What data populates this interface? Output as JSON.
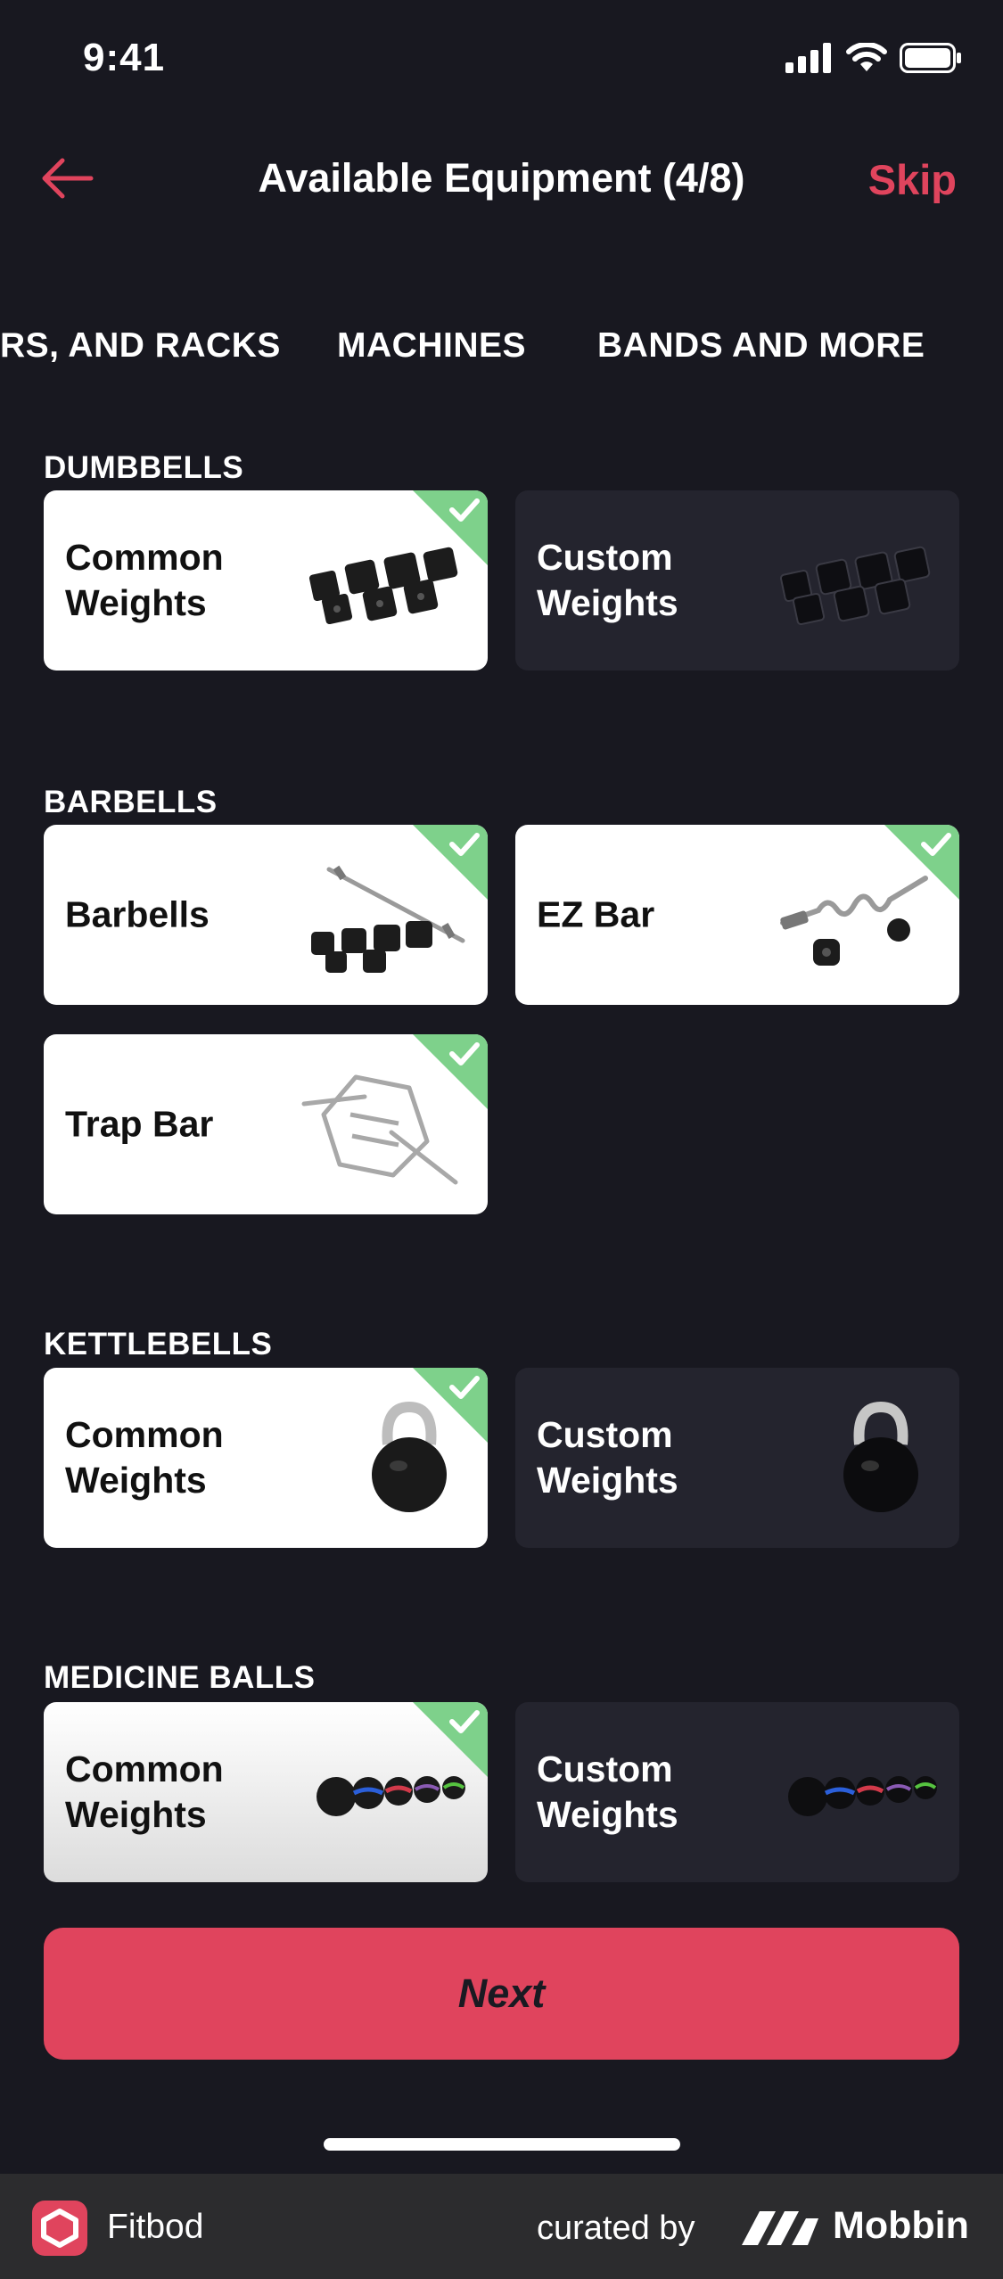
{
  "status_bar": {
    "time": "9:41"
  },
  "nav": {
    "title": "Available Equipment (4/8)",
    "skip_label": "Skip"
  },
  "tabs": [
    {
      "label": "RS, AND RACKS"
    },
    {
      "label": "MACHINES"
    },
    {
      "label": "BANDS AND MORE"
    }
  ],
  "sections": [
    {
      "title": "DUMBBELLS",
      "cards": [
        {
          "label": "Common Weights",
          "selected": true,
          "icon": "dumbbells-icon"
        },
        {
          "label": "Custom Weights",
          "selected": false,
          "icon": "dumbbells-icon"
        }
      ]
    },
    {
      "title": "BARBELLS",
      "cards": [
        {
          "label": "Barbells",
          "selected": true,
          "icon": "barbell-icon"
        },
        {
          "label": "EZ Bar",
          "selected": true,
          "icon": "ez-bar-icon"
        },
        {
          "label": "Trap Bar",
          "selected": true,
          "icon": "trap-bar-icon"
        }
      ]
    },
    {
      "title": "KETTLEBELLS",
      "cards": [
        {
          "label": "Common Weights",
          "selected": true,
          "icon": "kettlebell-icon"
        },
        {
          "label": "Custom Weights",
          "selected": false,
          "icon": "kettlebell-icon"
        }
      ]
    },
    {
      "title": "MEDICINE BALLS",
      "cards": [
        {
          "label": "Common Weights",
          "selected": true,
          "icon": "medicine-balls-icon"
        },
        {
          "label": "Custom Weights",
          "selected": false,
          "icon": "medicine-balls-icon"
        }
      ]
    }
  ],
  "next_label": "Next",
  "footer": {
    "app_name": "Fitbod",
    "curated_by": "curated by",
    "brand": "Mobbin"
  },
  "colors": {
    "background": "#181820",
    "accent": "#e0445d",
    "card_selected": "#ffffff",
    "card_unselected": "#24242e",
    "check_badge": "#7ed18b"
  }
}
